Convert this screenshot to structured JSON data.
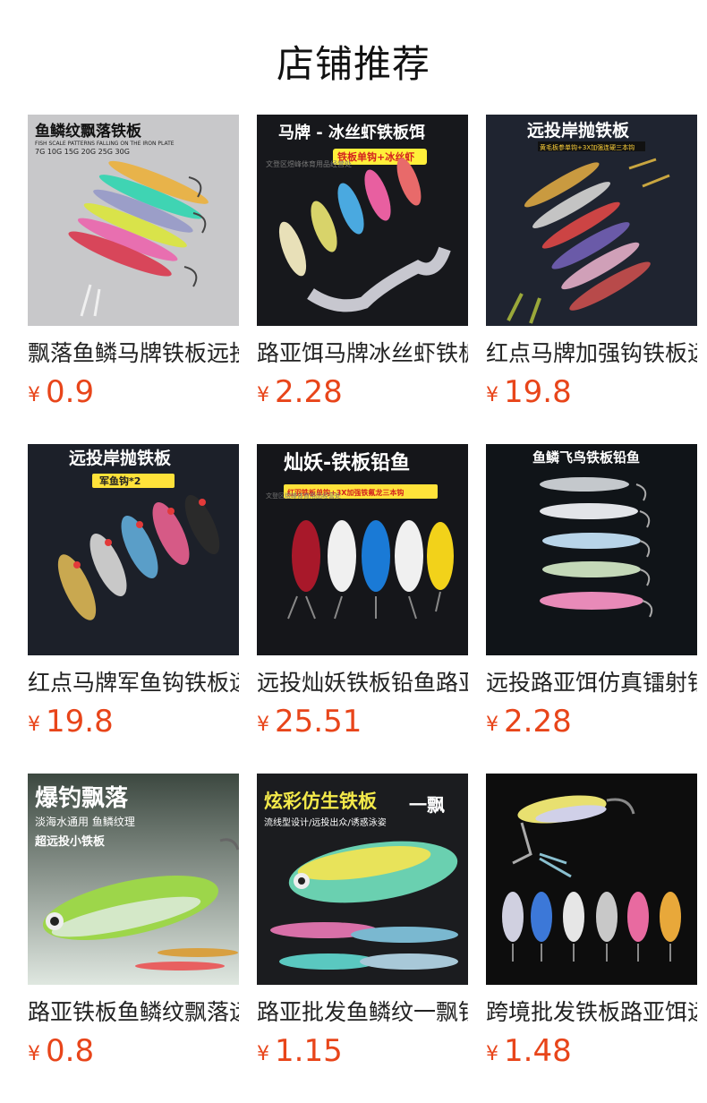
{
  "header": {
    "title": "店铺推荐"
  },
  "currency": "¥",
  "products": [
    {
      "title": "飘落鱼鳞马牌铁板远投",
      "price": "0.9",
      "image": {
        "banner": "鱼鳞纹飘落铁板",
        "sub": "FISH SCALE PATTERNS FALLING ON THE IRON PLATE",
        "sub2": "7G 10G 15G 20G 25G 30G",
        "bg": "#c9c9cb",
        "bannerColor": "#111111"
      }
    },
    {
      "title": "路亚饵马牌冰丝虾铁板饵",
      "price": "2.28",
      "image": {
        "banner": "马牌 - 冰丝虾铁板饵",
        "tag": "铁板单钩+冰丝虾",
        "watermark": "文登区煜峰体育用品经营处",
        "bg": "#17181c",
        "bannerColor": "#ffffff"
      }
    },
    {
      "title": "红点马牌加强钩铁板远投",
      "price": "19.8",
      "image": {
        "banner": "远投岸抛铁板",
        "tag": "黄毛板参单钩+3X加强连硬三本钩",
        "bg": "#1f2430",
        "bannerColor": "#ffffff"
      }
    },
    {
      "title": "红点马牌军鱼钩铁板远投",
      "price": "19.8",
      "image": {
        "banner": "远投岸抛铁板",
        "tag": "军鱼钩*2",
        "bg": "#1c2029",
        "bannerColor": "#ffffff"
      }
    },
    {
      "title": "远投灿妖铁板铅鱼路亚",
      "price": "25.51",
      "image": {
        "banner": "灿妖-铁板铅鱼",
        "tag": "红羽铁板单钩+3X加强铁氟龙三本钩",
        "watermark": "文登区煜峰体育用品经营处",
        "bg": "#15161a",
        "bannerColor": "#ffffff"
      }
    },
    {
      "title": "远投路亚饵仿真镭射铁板",
      "price": "2.28",
      "image": {
        "banner": "鱼鳞飞鸟铁板铅鱼",
        "bg": "#101418",
        "bannerColor": "#ffffff"
      }
    },
    {
      "title": "路亚铁板鱼鳞纹飘落远投",
      "price": "0.8",
      "image": {
        "banner": "爆钓飘落",
        "line1": "淡海水通用 鱼鳞纹理",
        "line2": "超远投小铁板",
        "bg": "#5f6f66",
        "bannerColor": "#ffffff"
      }
    },
    {
      "title": "路亚批发鱼鳞纹一飘铁板",
      "price": "1.15",
      "image": {
        "banner": "炫彩仿生铁板",
        "badge": "一飘",
        "line1": "流线型设计/远投出众/诱惑泳姿",
        "bg": "#1b1c1f",
        "bannerColor": "#f3e94a"
      }
    },
    {
      "title": "跨境批发铁板路亚饵远投",
      "price": "1.48",
      "image": {
        "bg": "#0d0d0d"
      }
    }
  ]
}
